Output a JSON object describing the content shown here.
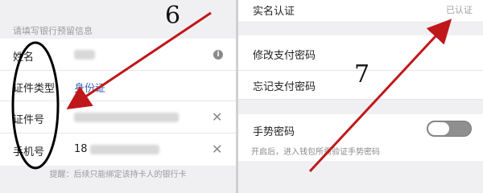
{
  "left": {
    "hint": "请填写银行预留信息",
    "fields": [
      {
        "label": "姓名",
        "value": ""
      },
      {
        "label": "证件类型",
        "value": "身份证"
      },
      {
        "label": "证件号",
        "value": ""
      },
      {
        "label": "手机号",
        "value": "18"
      }
    ],
    "bottom_hint": "提醒：后续只能绑定该持卡人的银行卡"
  },
  "right": {
    "realname_label": "实名认证",
    "realname_status": "已认证",
    "change_pay_password": "修改支付密码",
    "forgot_pay_password": "忘记支付密码",
    "gesture_password": "手势密码",
    "gesture_desc": "开启后，进入钱包所需验证手势密码"
  },
  "annotations": {
    "digit_left": "6",
    "digit_right": "7"
  },
  "icons": {
    "info": "info-icon",
    "clear": "close-icon",
    "toggle": "toggle-switch"
  },
  "colors": {
    "arrow": "#c0171a",
    "link_blue": "#3a66b8"
  }
}
